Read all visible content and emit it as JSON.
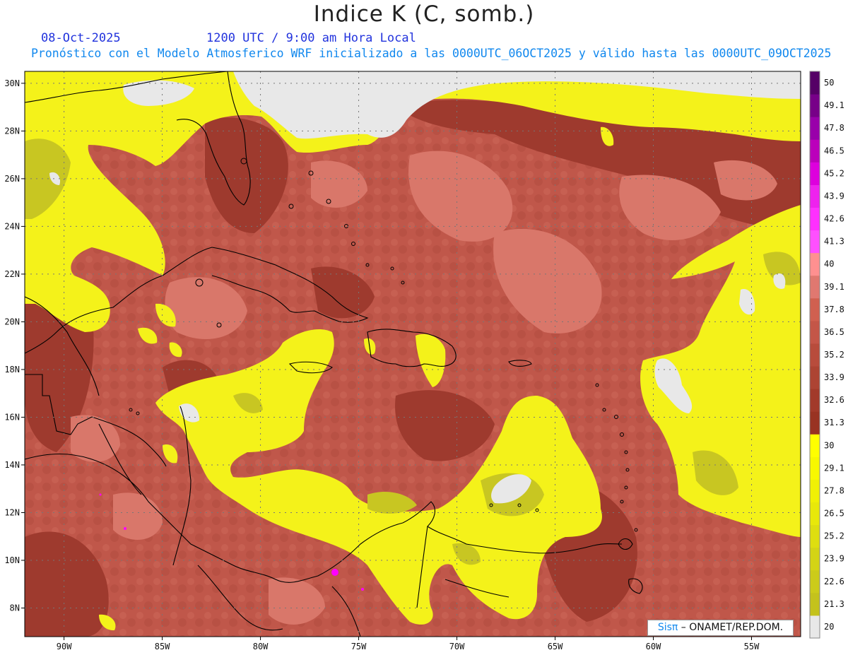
{
  "title": "Indice K (C, somb.)",
  "date_label": "08-Oct-2025",
  "time_label": "1200 UTC / 9:00 am Hora Local",
  "model_label": "Pronóstico con el Modelo Atmosferico WRF inicializado a las 0000UTC_06OCT2025 y válido hasta las  0000UTC_09OCT2025",
  "credit": {
    "sis": "Sisπ",
    "org": " – ONAMET/REP.DOM."
  },
  "map": {
    "lon_range": [
      -92,
      -52.5
    ],
    "lat_range": [
      6.8,
      30.5
    ],
    "lat_ticks": [
      "8N",
      "10N",
      "12N",
      "14N",
      "16N",
      "18N",
      "20N",
      "22N",
      "24N",
      "26N",
      "28N",
      "30N"
    ],
    "lon_ticks": [
      "90W",
      "85W",
      "80W",
      "75W",
      "70W",
      "65W",
      "60W",
      "55W"
    ],
    "colorbar": {
      "labels": [
        "20",
        "21.3",
        "22.6",
        "23.9",
        "25.2",
        "26.5",
        "27.8",
        "29.1",
        "30",
        "31.3",
        "32.6",
        "33.9",
        "35.2",
        "36.5",
        "37.8",
        "39.1",
        "40",
        "41.3",
        "42.6",
        "43.9",
        "45.2",
        "46.5",
        "47.8",
        "49.1",
        "50"
      ],
      "colors": [
        "#e8e8e8",
        "#c4c21c",
        "#cccb1a",
        "#d4d416",
        "#dede10",
        "#e8e80a",
        "#f0f005",
        "#f8f800",
        "#ffff00",
        "#993322",
        "#a23a2a",
        "#ad4433",
        "#b84c3c",
        "#c45648",
        "#d06050",
        "#e07870",
        "#ff9090",
        "#ff50ff",
        "#ff30ff",
        "#ee22ee",
        "#dd00dd",
        "#bb00bb",
        "#9900aa",
        "#770088",
        "#550066"
      ]
    },
    "colors": {
      "background": "#c0574a",
      "dark": "#9e3a2e",
      "light": "#d9776a",
      "yellow": "#f4f21a",
      "olive": "#c8c622",
      "white": "#e8e8e8"
    }
  }
}
